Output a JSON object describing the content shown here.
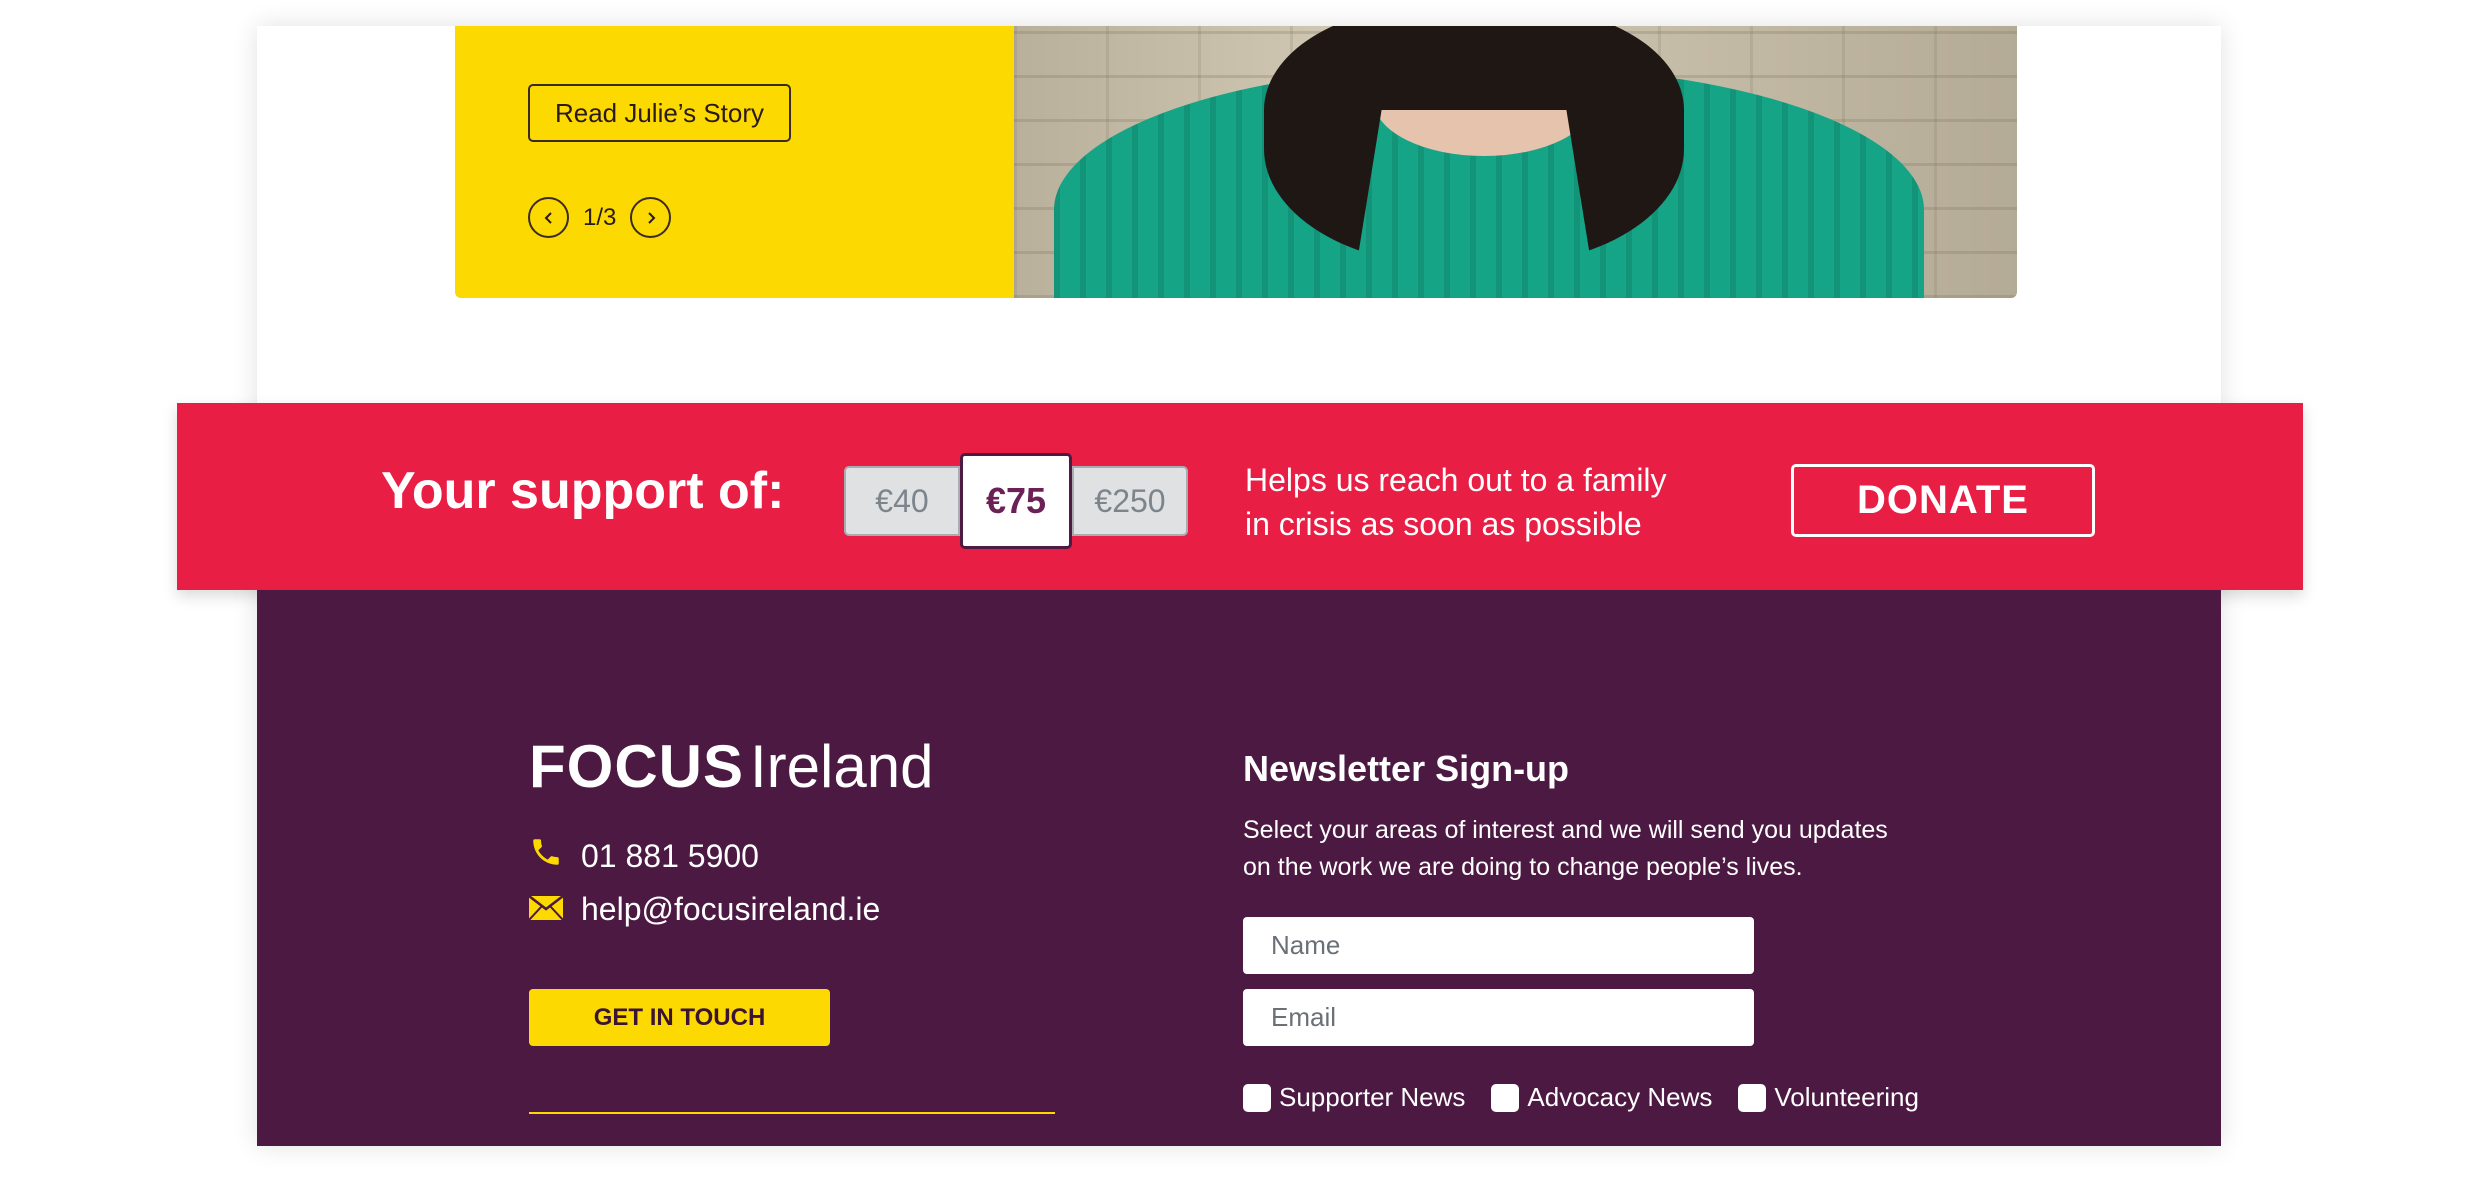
{
  "story": {
    "read_button": "Read Julie’s Story",
    "pager_count": "1/3",
    "prev_icon": "chevron-left-icon",
    "next_icon": "chevron-right-icon",
    "panel_color": "#fcd900"
  },
  "donate": {
    "support_label": "Your support of:",
    "amounts": [
      "€40",
      "€75",
      "€250"
    ],
    "selected_amount": "€75",
    "helps_line1": "Helps us reach out to a family",
    "helps_line2": "in crisis as soon as possible",
    "donate_button": "DONATE",
    "bar_color": "#e91e45"
  },
  "footer": {
    "logo_focus": "FOCUS",
    "logo_ireland": "Ireland",
    "phone": "01 881 5900",
    "email": "help@focusireland.ie",
    "phone_icon": "phone-icon",
    "email_icon": "envelope-icon",
    "get_in_touch": "GET IN TOUCH",
    "background_color": "#4b1942",
    "accent_color": "#fcd900"
  },
  "newsletter": {
    "title": "Newsletter Sign-up",
    "description_line1": "Select your areas of interest and we will send you updates",
    "description_line2": "on the work we are doing to change people’s lives.",
    "name_placeholder": "Name",
    "email_placeholder": "Email",
    "interests": [
      "Supporter News",
      "Advocacy News",
      "Volunteering"
    ]
  }
}
